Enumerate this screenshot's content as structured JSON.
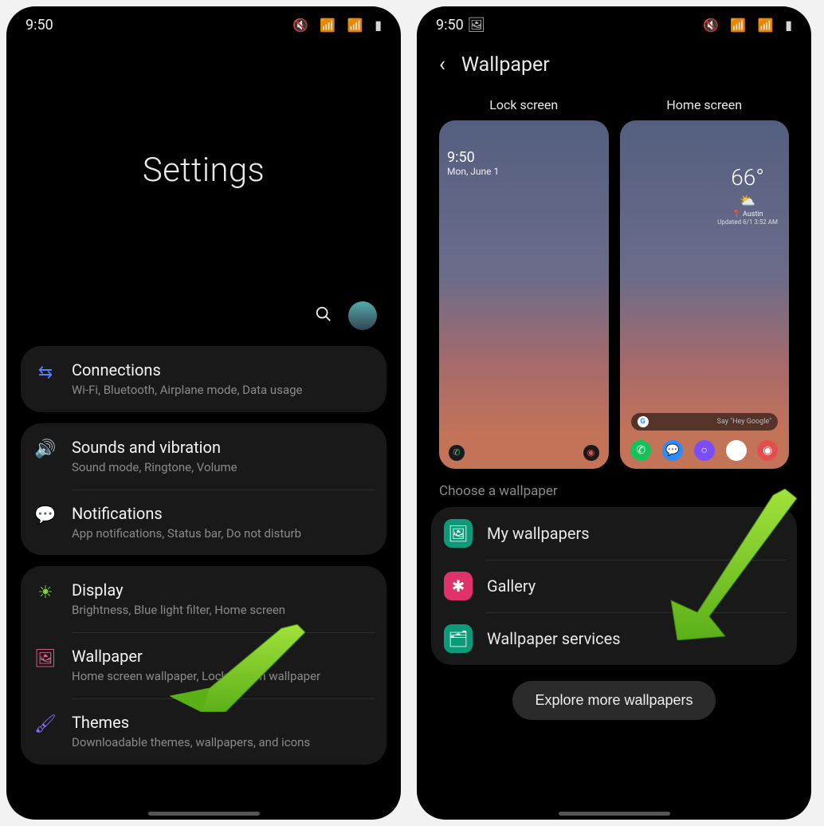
{
  "statusbar": {
    "time": "9:50"
  },
  "left": {
    "title": "Settings",
    "groups": [
      [
        {
          "icon": "wifi-icon",
          "color": "#5b7cff",
          "glyph": "⇆",
          "title": "Connections",
          "sub": "Wi-Fi, Bluetooth, Airplane mode, Data usage"
        }
      ],
      [
        {
          "icon": "volume-icon",
          "color": "#8c6cff",
          "glyph": "🔊",
          "title": "Sounds and vibration",
          "sub": "Sound mode, Ringtone, Volume"
        },
        {
          "icon": "notification-icon",
          "color": "#e06a4d",
          "glyph": "💬",
          "title": "Notifications",
          "sub": "App notifications, Status bar, Do not disturb"
        }
      ],
      [
        {
          "icon": "brightness-icon",
          "color": "#7bd23c",
          "glyph": "☀",
          "title": "Display",
          "sub": "Brightness, Blue light filter, Home screen"
        },
        {
          "icon": "wallpaper-icon",
          "color": "#e85a8c",
          "glyph": "🖼",
          "title": "Wallpaper",
          "sub": "Home screen wallpaper, Lock screen wallpaper"
        },
        {
          "icon": "themes-icon",
          "color": "#8c6cff",
          "glyph": "🖌",
          "title": "Themes",
          "sub": "Downloadable themes, wallpapers, and icons"
        }
      ]
    ]
  },
  "right": {
    "title": "Wallpaper",
    "previews": {
      "lock": {
        "label": "Lock screen",
        "time": "9:50",
        "date": "Mon, June 1"
      },
      "home": {
        "label": "Home screen",
        "temp": "66°",
        "city": "Austin",
        "updated": "Updated 6/1 3:52 AM",
        "search": "Say \"Hey Google\""
      }
    },
    "choose_label": "Choose a wallpaper",
    "sources": [
      {
        "icon": "picture-icon",
        "bg": "#0b9b7a",
        "glyph": "🖼",
        "title": "My wallpapers"
      },
      {
        "icon": "gallery-icon",
        "bg": "#e0316a",
        "glyph": "✱",
        "title": "Gallery"
      },
      {
        "icon": "services-icon",
        "bg": "#0b9b7a",
        "glyph": "🗂",
        "title": "Wallpaper services"
      }
    ],
    "explore": "Explore more wallpapers"
  }
}
